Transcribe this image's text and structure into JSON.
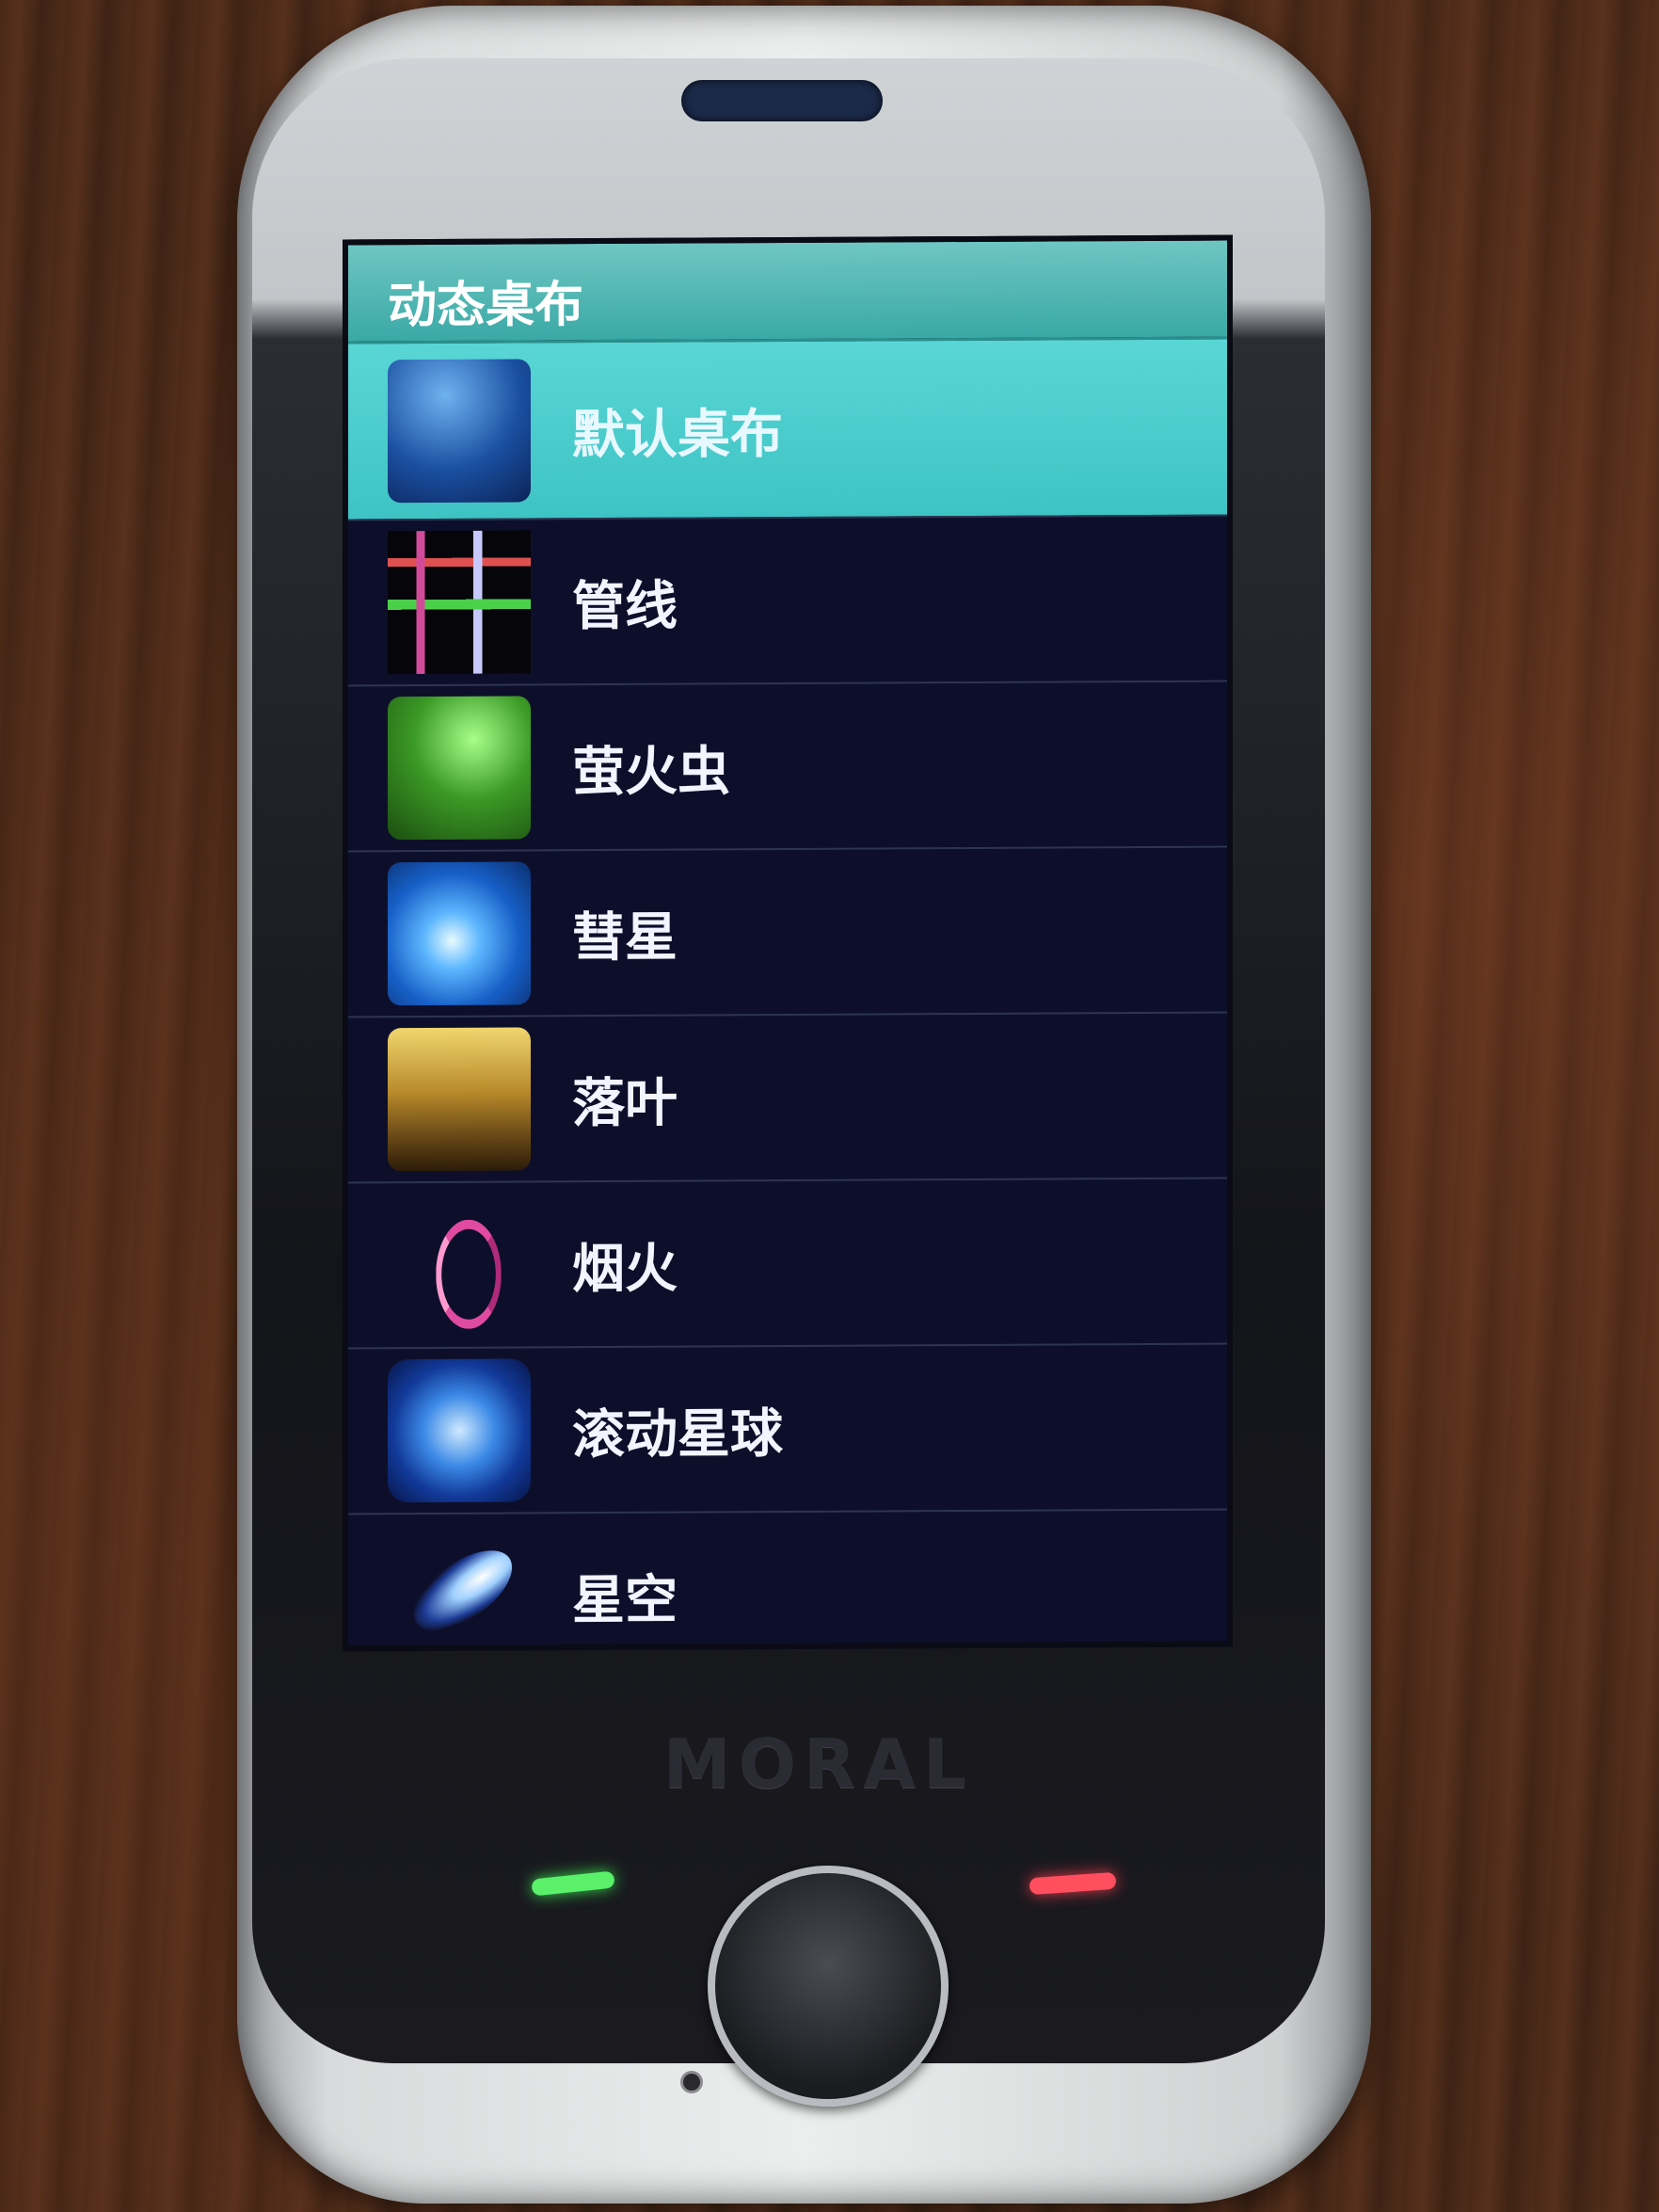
{
  "screen": {
    "title": "动态桌布",
    "items": [
      {
        "label": "默认桌布",
        "icon": "default-wallpaper-icon",
        "selected": true
      },
      {
        "label": "管线",
        "icon": "pipes-icon",
        "selected": false
      },
      {
        "label": "萤火虫",
        "icon": "firefly-icon",
        "selected": false
      },
      {
        "label": "彗星",
        "icon": "comet-icon",
        "selected": false
      },
      {
        "label": "落叶",
        "icon": "leaves-icon",
        "selected": false
      },
      {
        "label": "烟火",
        "icon": "fireworks-icon",
        "selected": false
      },
      {
        "label": "滚动星球",
        "icon": "globe-icon",
        "selected": false
      },
      {
        "label": "星空",
        "icon": "starry-sky-icon",
        "selected": false
      }
    ]
  },
  "device": {
    "brand": "MORAL"
  },
  "colors": {
    "title_bar": "#3aa9a6",
    "selected_row": "#4ccccc",
    "list_background": "#0d0f2a",
    "call_key": "#5af06a",
    "end_key": "#ff4e5e"
  }
}
